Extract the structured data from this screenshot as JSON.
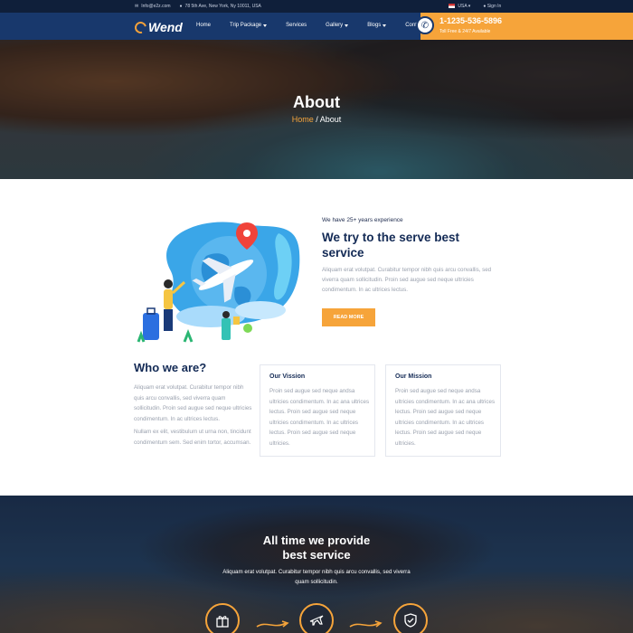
{
  "topbar": {
    "email": "Info@e2z.com",
    "address": "78 5th Ave, New York, Ny 10011, USA",
    "country": "USA",
    "signin": "Sign In"
  },
  "nav": {
    "logo": "Wend",
    "menu": [
      {
        "label": "Home",
        "dropdown": false
      },
      {
        "label": "Trip Package",
        "dropdown": true
      },
      {
        "label": "Services",
        "dropdown": false
      },
      {
        "label": "Gallery",
        "dropdown": true
      },
      {
        "label": "Blogs",
        "dropdown": true
      },
      {
        "label": "Contact Us",
        "dropdown": false
      }
    ],
    "phone": "1-1235-536-5896",
    "toll_free": "Toll Free & 24/7 Available"
  },
  "hero": {
    "title": "About",
    "breadcrumb_home": "Home",
    "breadcrumb_sep": " / ",
    "breadcrumb_current": "About"
  },
  "experience": {
    "tagline": "We have 25+ years experience",
    "title": "We try to the serve best service",
    "text": "Aliquam erat volutpat. Curabitur tempor nibh quis arcu convallis, sed viverra quam sollicitudin. Proin sed augue sed neque ultricies condimentum. In ac ultrices lectus.",
    "button": "READ MORE"
  },
  "who": {
    "title": "Who we are?",
    "p1": "Aliquam erat volutpat. Curabitur tempor nibh quis arcu convallis, sed viverra quam sollicitudin. Proin sed augue sed neque ultricies condimentum. In ac ultrices lectus.",
    "p2": "Nullam ex elit, vestibulum ut urna non, tincidunt condimentum sem. Sed enim tortor, accumsan.",
    "vision_title": "Our Vission",
    "vision_text": "Proin sed augue sed neque andsa ultricies condimentum. In ac ana ultrices lectus. Proin sed augue sed neque ultricies condimentum. In ac ultrices lectus. Proin sed augue sed neque ultricies.",
    "mission_title": "Our Mission",
    "mission_text": "Proin sed augue sed neque andsa ultricies condimentum. In ac ana ultrices lectus. Proin sed augue sed neque ultricies condimentum. In ac ultrices lectus. Proin sed augue sed neque ultricies."
  },
  "band": {
    "title_line1": "All time we provide",
    "title_line2": "best service",
    "text": "Aliquam erat volutpat. Curabitur tempor nibh quis arcu convallis, sed viverra quam sollicitudin.",
    "icons": [
      "gift-icon",
      "plane-icon",
      "shield-icon"
    ]
  },
  "colors": {
    "accent": "#f6a43a",
    "nav": "#18386c",
    "topbar": "#0f1f3a",
    "heading": "#132a55",
    "body_text": "#9aa1ae"
  }
}
